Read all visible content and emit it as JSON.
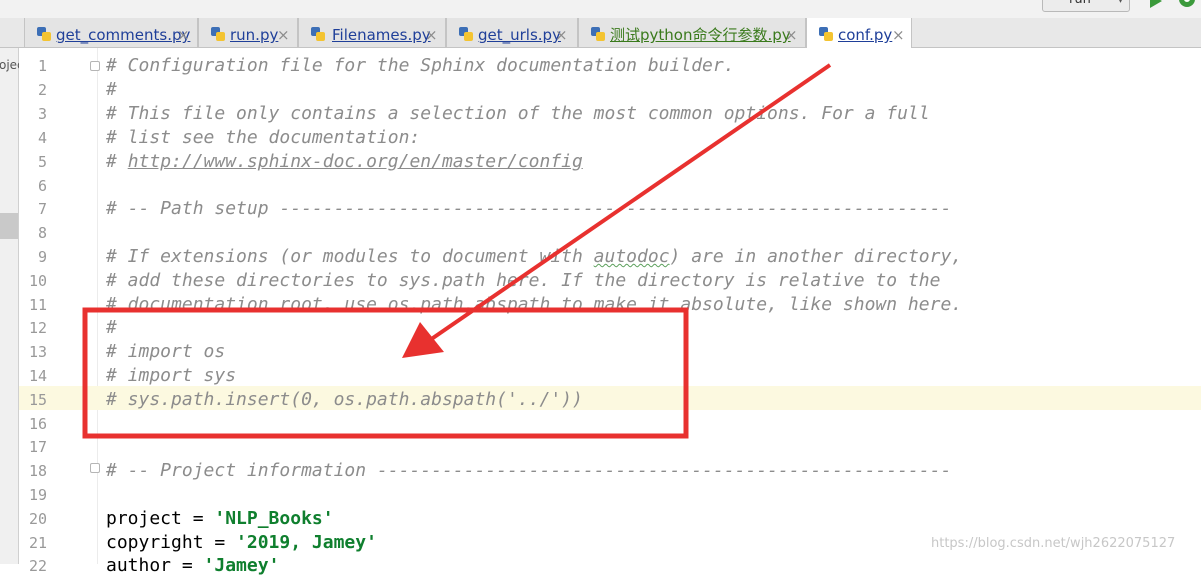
{
  "toolbar": {
    "run_config": "run",
    "run_icon": "play-icon",
    "debug_icon": "bug-icon"
  },
  "tabs": [
    {
      "label": "get_comments.py",
      "active": false
    },
    {
      "label": "run.py",
      "active": false
    },
    {
      "label": "Filenames.py",
      "active": false
    },
    {
      "label": "get_urls.py",
      "active": false
    },
    {
      "label": "测试python命令行参数.py",
      "active": false
    },
    {
      "label": "conf.py",
      "active": true
    }
  ],
  "tab_close_glyph": "×",
  "project_panel": {
    "label": "ojec"
  },
  "editor": {
    "current_line": 15,
    "lines": [
      {
        "n": "1"
      },
      {
        "n": "2"
      },
      {
        "n": "3"
      },
      {
        "n": "4"
      },
      {
        "n": "5"
      },
      {
        "n": "6"
      },
      {
        "n": "7"
      },
      {
        "n": "8"
      },
      {
        "n": "9"
      },
      {
        "n": "10"
      },
      {
        "n": "11"
      },
      {
        "n": "12"
      },
      {
        "n": "13"
      },
      {
        "n": "14"
      },
      {
        "n": "15"
      },
      {
        "n": "16"
      },
      {
        "n": "17"
      },
      {
        "n": "18"
      },
      {
        "n": "19"
      },
      {
        "n": "20"
      },
      {
        "n": "21"
      },
      {
        "n": "22"
      }
    ],
    "code": {
      "l1": "# Configuration file for the Sphinx documentation builder.",
      "l2": "#",
      "l3": "# This file only contains a selection of the most common options. For a full",
      "l4": "# list see the documentation:",
      "l5_prefix": "# ",
      "l5_url": "http://www.sphinx-doc.org/en/master/config",
      "l7": "# -- Path setup --------------------------------------------------------------",
      "l9_a": "# If extensions (or modules to document with ",
      "l9_b": "autodoc",
      "l9_c": ") are in another directory,",
      "l10": "# add these directories to sys.path here. If the directory is relative to the",
      "l11": "# documentation root, use os.path.abspath to make it absolute, like shown here.",
      "l12": "#",
      "l13": "# import os",
      "l14": "# import sys",
      "l15": "# sys.path.insert(0, os.path.abspath('../'))",
      "l18": "# -- Project information -----------------------------------------------------",
      "l20_a": "project = ",
      "l20_b": "'NLP_Books'",
      "l21_a": "copyright = ",
      "l21_b": "'2019, Jamey'",
      "l22_a": "author = ",
      "l22_b": "'Jamey'"
    }
  },
  "annotation": {
    "box_color": "#e8312f",
    "arrow_color": "#e8312f"
  },
  "watermark": "https://blog.csdn.net/wjh2622075127"
}
